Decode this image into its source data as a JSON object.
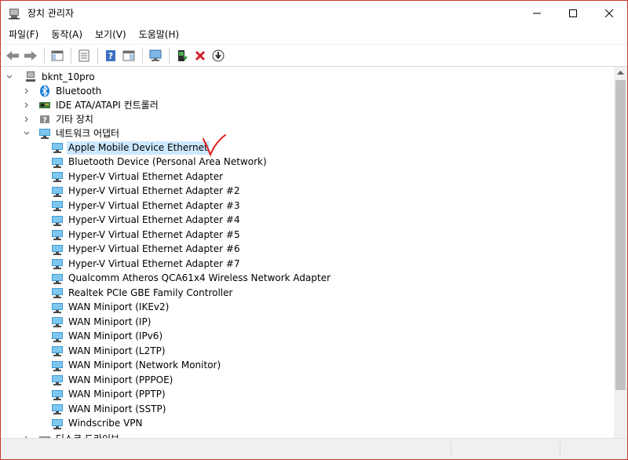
{
  "window": {
    "title": "장치 관리자"
  },
  "menu": [
    "파일(F)",
    "동작(A)",
    "보기(V)",
    "도움말(H)"
  ],
  "toolbar": {
    "buttons": [
      "back-icon",
      "forward-icon",
      "show-hide-tree-icon",
      "properties-icon",
      "help-icon",
      "view-icon",
      "monitor-icon",
      "update-driver-icon",
      "uninstall-icon",
      "download-icon"
    ]
  },
  "tree": {
    "root": "bknt_10pro",
    "categories": [
      {
        "label": "Bluetooth",
        "icon": "bluetooth-icon",
        "expanded": false
      },
      {
        "label": "IDE ATA/ATAPI 컨트롤러",
        "icon": "ide-controller-icon",
        "expanded": false
      },
      {
        "label": "기타 장치",
        "icon": "other-device-icon",
        "expanded": false
      },
      {
        "label": "네트워크 어댑터",
        "icon": "network-adapter-icon",
        "expanded": true
      }
    ],
    "network_adapters": [
      "Apple Mobile Device Ethernet",
      "Bluetooth Device (Personal Area Network)",
      "Hyper-V Virtual Ethernet Adapter",
      "Hyper-V Virtual Ethernet Adapter #2",
      "Hyper-V Virtual Ethernet Adapter #3",
      "Hyper-V Virtual Ethernet Adapter #4",
      "Hyper-V Virtual Ethernet Adapter #5",
      "Hyper-V Virtual Ethernet Adapter #6",
      "Hyper-V Virtual Ethernet Adapter #7",
      "Qualcomm Atheros QCA61x4 Wireless Network Adapter",
      "Realtek PCIe GBE Family Controller",
      "WAN Miniport (IKEv2)",
      "WAN Miniport (IP)",
      "WAN Miniport (IPv6)",
      "WAN Miniport (L2TP)",
      "WAN Miniport (Network Monitor)",
      "WAN Miniport (PPPOE)",
      "WAN Miniport (PPTP)",
      "WAN Miniport (SSTP)",
      "Windscribe VPN"
    ],
    "selected": "Apple Mobile Device Ethernet",
    "next_category": "디스크 드라이브"
  }
}
